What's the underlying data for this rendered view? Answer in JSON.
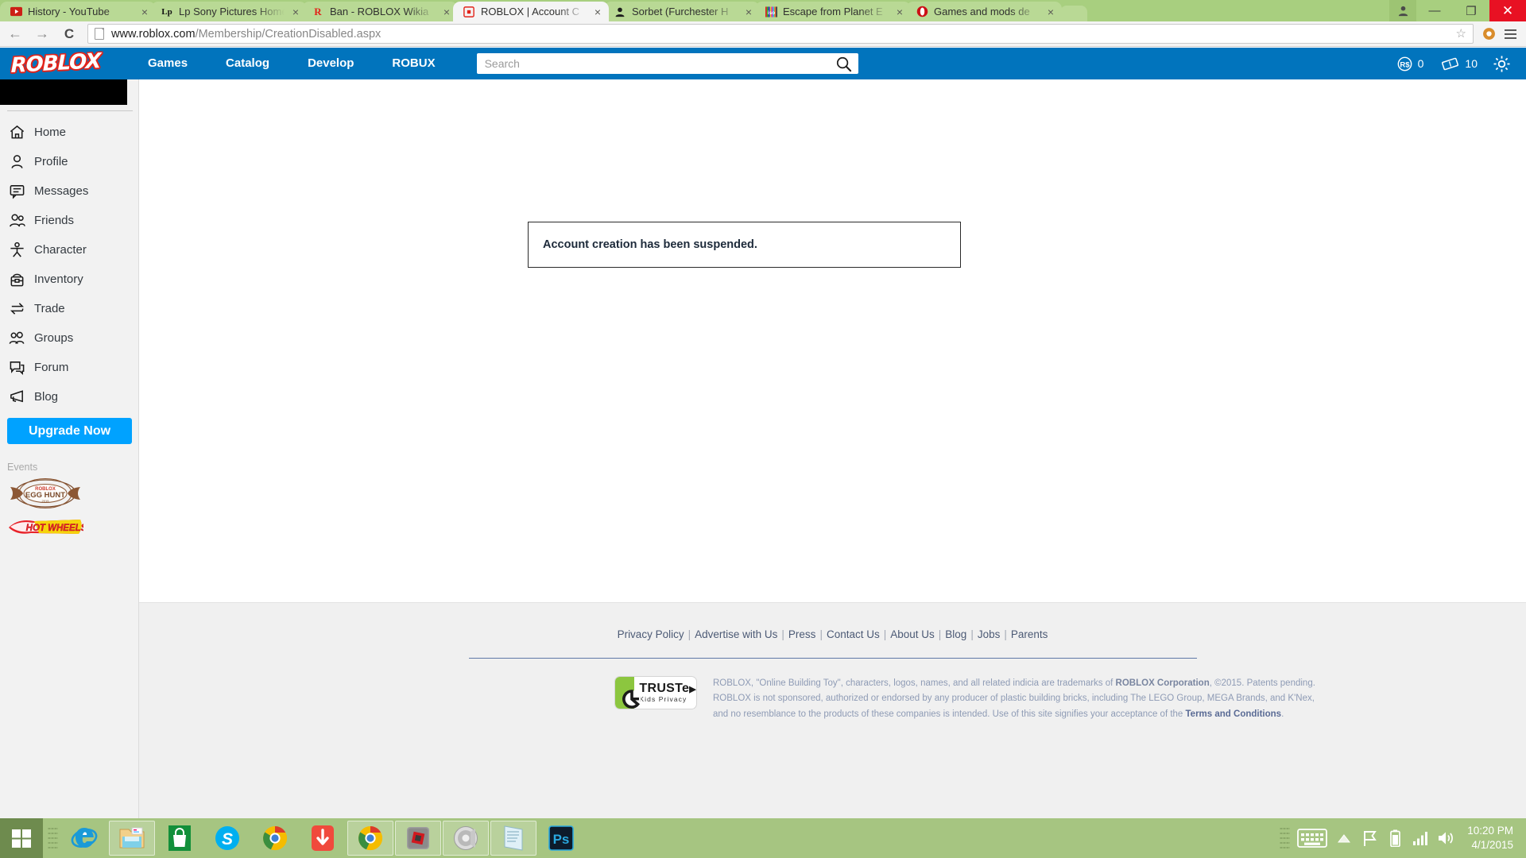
{
  "browser": {
    "tabs": [
      {
        "title": "History - YouTube",
        "favicon": "youtube-icon",
        "active": false
      },
      {
        "title": "Lp Sony Pictures Home",
        "favicon": "sony-icon",
        "active": false
      },
      {
        "title": "Ban - ROBLOX Wikia",
        "favicon": "wikia-icon",
        "active": false
      },
      {
        "title": "ROBLOX | Account C",
        "favicon": "roblox-icon",
        "active": true
      },
      {
        "title": "Sorbet (Furchester H",
        "favicon": "person-icon",
        "active": false
      },
      {
        "title": "Escape from Planet E",
        "favicon": "iso-icon",
        "active": false
      },
      {
        "title": "Games and mods de",
        "favicon": "opera-icon",
        "active": false
      }
    ],
    "close_glyph": "×",
    "window_controls": {
      "user": "●",
      "minimize": "—",
      "maximize": "❐",
      "close": "✕"
    },
    "back_glyph": "←",
    "forward_glyph": "→",
    "reload_glyph": "C",
    "url_domain": "www.roblox.com",
    "url_path": "/Membership/CreationDisabled.aspx",
    "star_glyph": "☆"
  },
  "roblox": {
    "logo": "ROBLOX",
    "nav_links": [
      "Games",
      "Catalog",
      "Develop",
      "ROBUX"
    ],
    "search": {
      "value": "",
      "placeholder": "Search"
    },
    "currency": {
      "robux_label": "R$",
      "robux_value": "0",
      "tickets_value": "10"
    },
    "sidebar": {
      "items": [
        {
          "label": "Home",
          "icon": "home-icon"
        },
        {
          "label": "Profile",
          "icon": "person-icon"
        },
        {
          "label": "Messages",
          "icon": "message-icon"
        },
        {
          "label": "Friends",
          "icon": "friends-icon"
        },
        {
          "label": "Character",
          "icon": "character-icon"
        },
        {
          "label": "Inventory",
          "icon": "inventory-icon"
        },
        {
          "label": "Trade",
          "icon": "trade-icon"
        },
        {
          "label": "Groups",
          "icon": "groups-icon"
        },
        {
          "label": "Forum",
          "icon": "forum-icon"
        },
        {
          "label": "Blog",
          "icon": "blog-icon"
        }
      ],
      "upgrade_label": "Upgrade Now",
      "events_heading": "Events",
      "events": [
        {
          "name": "ROBLOX EGG HUNT",
          "icon": "egg-hunt-badge"
        },
        {
          "name": "HOT WHEELS",
          "icon": "hot-wheels-badge"
        }
      ]
    },
    "main": {
      "alert_message": "Account creation has been suspended."
    },
    "footer": {
      "links": [
        "Privacy Policy",
        "Advertise with Us",
        "Press",
        "Contact Us",
        "About Us",
        "Blog",
        "Jobs",
        "Parents"
      ],
      "separator": "|",
      "truste": {
        "title": "TRUSTe",
        "arrow": "▶",
        "subtitle": "Kids Privacy"
      },
      "legal_part1": "ROBLOX, \"Online Building Toy\", characters, logos, names, and all related indicia are trademarks of ",
      "legal_company": "ROBLOX Corporation",
      "legal_part2": ", ©2015. Patents pending. ROBLOX is not sponsored, authorized or endorsed by any producer of plastic building bricks, including The LEGO Group, MEGA Brands, and K'Nex, and no resemblance to the products of these companies is intended. Use of this site signifies your acceptance of the ",
      "legal_terms": "Terms and Conditions",
      "legal_part3": "."
    }
  },
  "taskbar": {
    "start_icon": "windows-start-icon",
    "apps": [
      {
        "name": "internet-explorer-icon",
        "running": false
      },
      {
        "name": "file-explorer-icon",
        "running": true
      },
      {
        "name": "windows-store-icon",
        "running": false
      },
      {
        "name": "skype-icon",
        "running": false
      },
      {
        "name": "chrome-icon",
        "running": false
      },
      {
        "name": "download-icon",
        "running": false
      },
      {
        "name": "chrome-window-icon",
        "running": true
      },
      {
        "name": "roblox-studio-icon",
        "running": true
      },
      {
        "name": "sound-recorder-icon",
        "running": true
      },
      {
        "name": "notepad-icon",
        "running": true
      },
      {
        "name": "photoshop-icon",
        "running": false
      }
    ],
    "tray": {
      "keyboard_icon": "keyboard-icon",
      "chevron_icon": "show-hidden-icons-icon",
      "flag_icon": "action-center-flag-icon",
      "battery_icon": "battery-icon",
      "network_icon": "network-signal-icon",
      "volume_icon": "volume-icon"
    },
    "clock": {
      "time": "10:20 PM",
      "date": "4/1/2015"
    }
  }
}
